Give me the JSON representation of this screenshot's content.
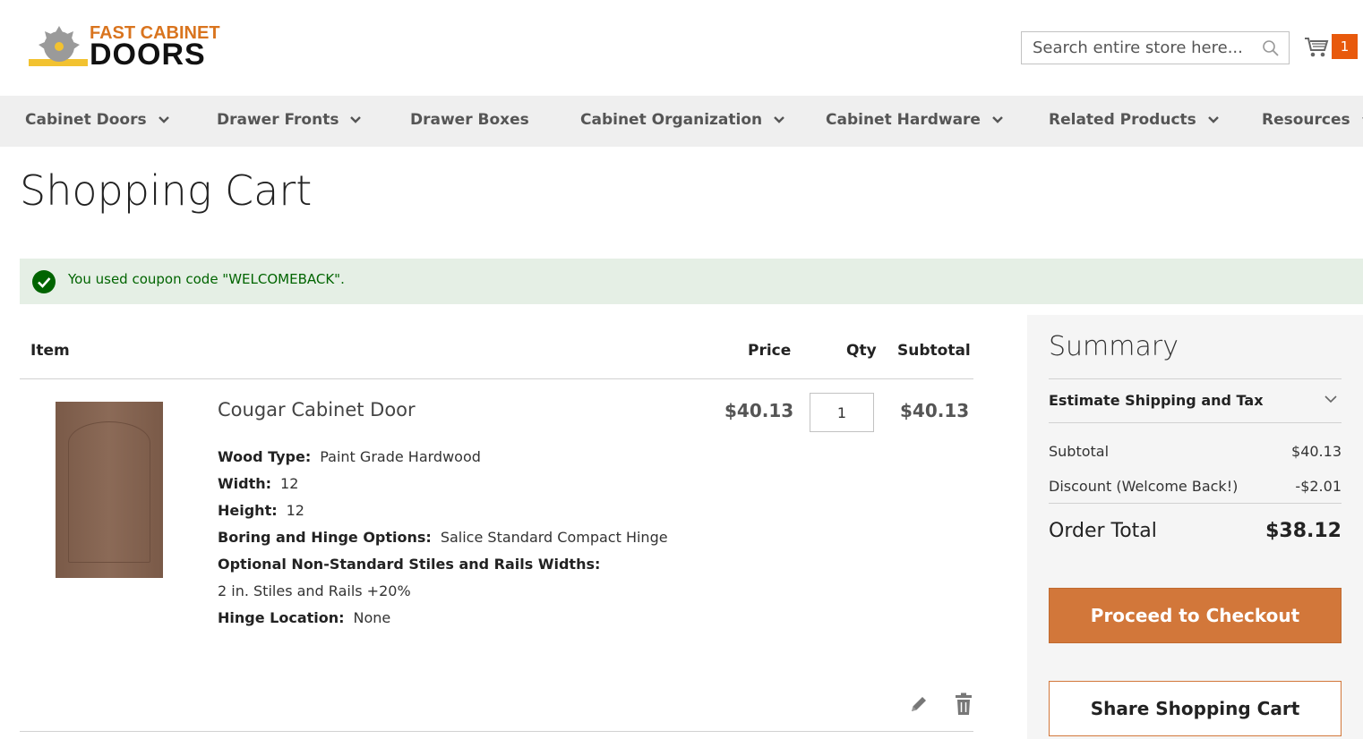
{
  "header": {
    "logo": {
      "line1": "FAST CABINET",
      "line2": "DOORS"
    },
    "search": {
      "placeholder": "Search entire store here..."
    },
    "cart": {
      "count": "1",
      "icon": "shopping-cart-icon"
    }
  },
  "nav": {
    "items": [
      {
        "label": "Cabinet Doors",
        "has_dropdown": true
      },
      {
        "label": "Drawer Fronts",
        "has_dropdown": true
      },
      {
        "label": "Drawer Boxes",
        "has_dropdown": false
      },
      {
        "label": "Cabinet Organization",
        "has_dropdown": true
      },
      {
        "label": "Cabinet Hardware",
        "has_dropdown": true
      },
      {
        "label": "Related Products",
        "has_dropdown": true
      },
      {
        "label": "Resources",
        "has_dropdown": true
      }
    ]
  },
  "page": {
    "title": "Shopping Cart"
  },
  "message": {
    "text": "You used coupon code \"WELCOMEBACK\"."
  },
  "cart_table": {
    "headers": {
      "item": "Item",
      "price": "Price",
      "qty": "Qty",
      "subtotal": "Subtotal"
    },
    "items": [
      {
        "name": "Cougar Cabinet Door",
        "price": "$40.13",
        "qty": "1",
        "subtotal": "$40.13",
        "options": [
          {
            "label": "Wood Type:",
            "value": "Paint Grade Hardwood"
          },
          {
            "label": "Width:",
            "value": "12"
          },
          {
            "label": "Height:",
            "value": "12"
          },
          {
            "label": "Boring and Hinge Options:",
            "value": "Salice Standard Compact Hinge"
          },
          {
            "label": "Optional Non-Standard Stiles and Rails Widths:",
            "value": ""
          },
          {
            "label": "",
            "value": "2 in. Stiles and Rails +20%"
          },
          {
            "label": "Hinge Location:",
            "value": "None"
          }
        ]
      }
    ]
  },
  "summary": {
    "title": "Summary",
    "estimate_label": "Estimate Shipping and Tax",
    "subtotal_label": "Subtotal",
    "subtotal_value": "$40.13",
    "discount_label": "Discount (Welcome Back!)",
    "discount_value": "-$2.01",
    "total_label": "Order Total",
    "total_value": "$38.12",
    "checkout_label": "Proceed to Checkout",
    "share_label": "Share Shopping Cart"
  },
  "colors": {
    "accent": "#d2773a",
    "nav_bg": "#efefef",
    "success_bg": "#e5efe5",
    "success_text": "#006400",
    "badge": "#e8590c"
  }
}
